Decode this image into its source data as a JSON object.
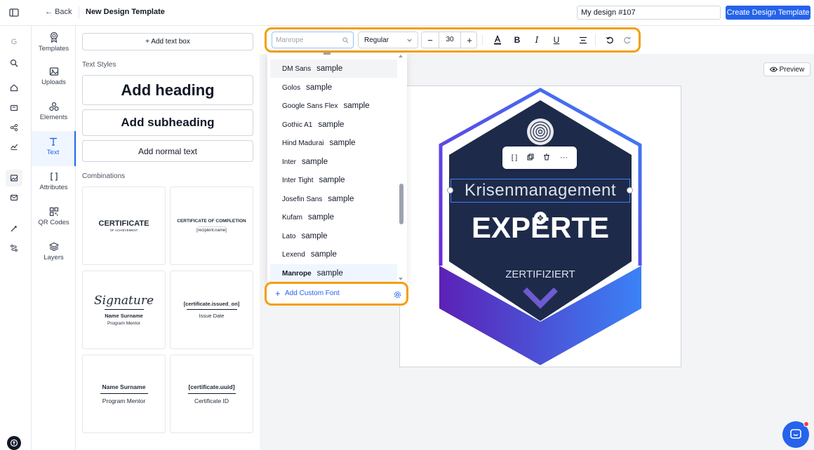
{
  "topbar": {
    "back_label": "Back",
    "title": "New Design Template",
    "design_name": "My design #107",
    "create_label": "Create Design Template"
  },
  "rail": {
    "logo": "G"
  },
  "tabs": [
    {
      "label": "Templates",
      "icon": "award-icon"
    },
    {
      "label": "Uploads",
      "icon": "image-icon"
    },
    {
      "label": "Elements",
      "icon": "shapes-icon"
    },
    {
      "label": "Text",
      "icon": "text-icon"
    },
    {
      "label": "Attributes",
      "icon": "brackets-icon"
    },
    {
      "label": "QR Codes",
      "icon": "qr-icon"
    },
    {
      "label": "Layers",
      "icon": "layers-icon"
    }
  ],
  "panel": {
    "add_text_box": "+ Add text box",
    "text_styles_label": "Text Styles",
    "add_heading": "Add heading",
    "add_subheading": "Add subheading",
    "add_normal_text": "Add normal text",
    "combinations_label": "Combinations",
    "combos": [
      {
        "title": "CERTIFICATE",
        "sub": "OF ACHIEVEMENT"
      },
      {
        "title": "CERTIFICATE OF COMPLETION",
        "sub": "[recipient.name]"
      },
      {
        "title": "Signature",
        "name": "Name Surname",
        "role": "Program Mentor"
      },
      {
        "title": "[certificate.issued_on]",
        "sub": "Issue Date"
      },
      {
        "title": "Name Surname",
        "sub": "Program Mentor"
      },
      {
        "title": "[certificate.uuid]",
        "sub": "Certificate ID"
      }
    ]
  },
  "toolbar": {
    "font_placeholder": "Manrope",
    "weight": "Regular",
    "size": "30",
    "minus": "−",
    "plus": "+"
  },
  "fontlist": {
    "items": [
      {
        "name": "DM Sans",
        "sample": "sample",
        "state": "hover"
      },
      {
        "name": "Golos",
        "sample": "sample",
        "state": ""
      },
      {
        "name": "Google Sans Flex",
        "sample": "sample",
        "state": ""
      },
      {
        "name": "Gothic A1",
        "sample": "sample",
        "state": ""
      },
      {
        "name": "Hind Madurai",
        "sample": "sample",
        "state": ""
      },
      {
        "name": "Inter",
        "sample": "sample",
        "state": ""
      },
      {
        "name": "Inter Tight",
        "sample": "sample",
        "state": ""
      },
      {
        "name": "Josefin Sans",
        "sample": "sample",
        "state": ""
      },
      {
        "name": "Kufam",
        "sample": "sample",
        "state": ""
      },
      {
        "name": "Lato",
        "sample": "sample",
        "state": ""
      },
      {
        "name": "Lexend",
        "sample": "sample",
        "state": ""
      },
      {
        "name": "Manrope",
        "sample": "sample",
        "state": "selected"
      }
    ],
    "add_custom": "Add Custom Font"
  },
  "canvas": {
    "preview_label": "Preview",
    "badge": {
      "line1": "Krisenmanagement",
      "line2": "EXPERTE",
      "line3": "ZERTIFIZIERT"
    },
    "element_toolbar": {
      "more": "···"
    }
  },
  "colors": {
    "accent": "#2563eb",
    "highlight": "#f59e0b",
    "badge_dark": "#1e2a4a",
    "badge_gradient_start": "#6d28d9",
    "badge_gradient_end": "#3b82f6"
  }
}
